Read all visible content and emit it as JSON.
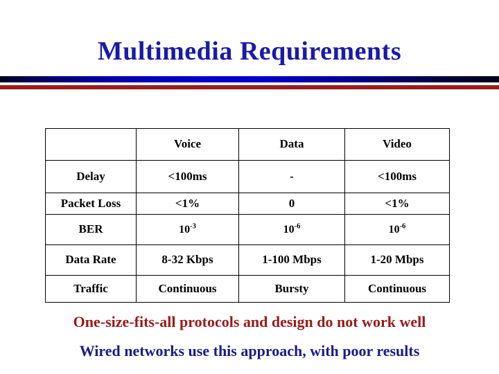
{
  "slide": {
    "title": "Multimedia Requirements",
    "accent_blue": "#1A1AA8",
    "accent_red": "#9C1919",
    "divider_blue": "#0000CC",
    "divider_red": "#9B1C19"
  },
  "table": {
    "headers": [
      "",
      "Voice",
      "Data",
      "Video"
    ],
    "rows": [
      {
        "label": "Delay",
        "voice": "<100ms",
        "data": "-",
        "video": "<100ms"
      },
      {
        "label": "Packet Loss",
        "voice": "<1%",
        "data": "0",
        "video": "<1%"
      },
      {
        "label": "BER",
        "voice_base": "10",
        "voice_exp": "-3",
        "data_base": "10",
        "data_exp": "-6",
        "video_base": "10",
        "video_exp": "-6"
      },
      {
        "label": "Data Rate",
        "voice": "8-32 Kbps",
        "data": "1-100 Mbps",
        "video": "1-20 Mbps"
      },
      {
        "label": "Traffic",
        "voice": "Continuous",
        "data": "Bursty",
        "video": "Continuous"
      }
    ]
  },
  "notes": {
    "line1": "One-size-fits-all protocols and design do not work well",
    "line2": "Wired networks use this approach, with poor results"
  }
}
